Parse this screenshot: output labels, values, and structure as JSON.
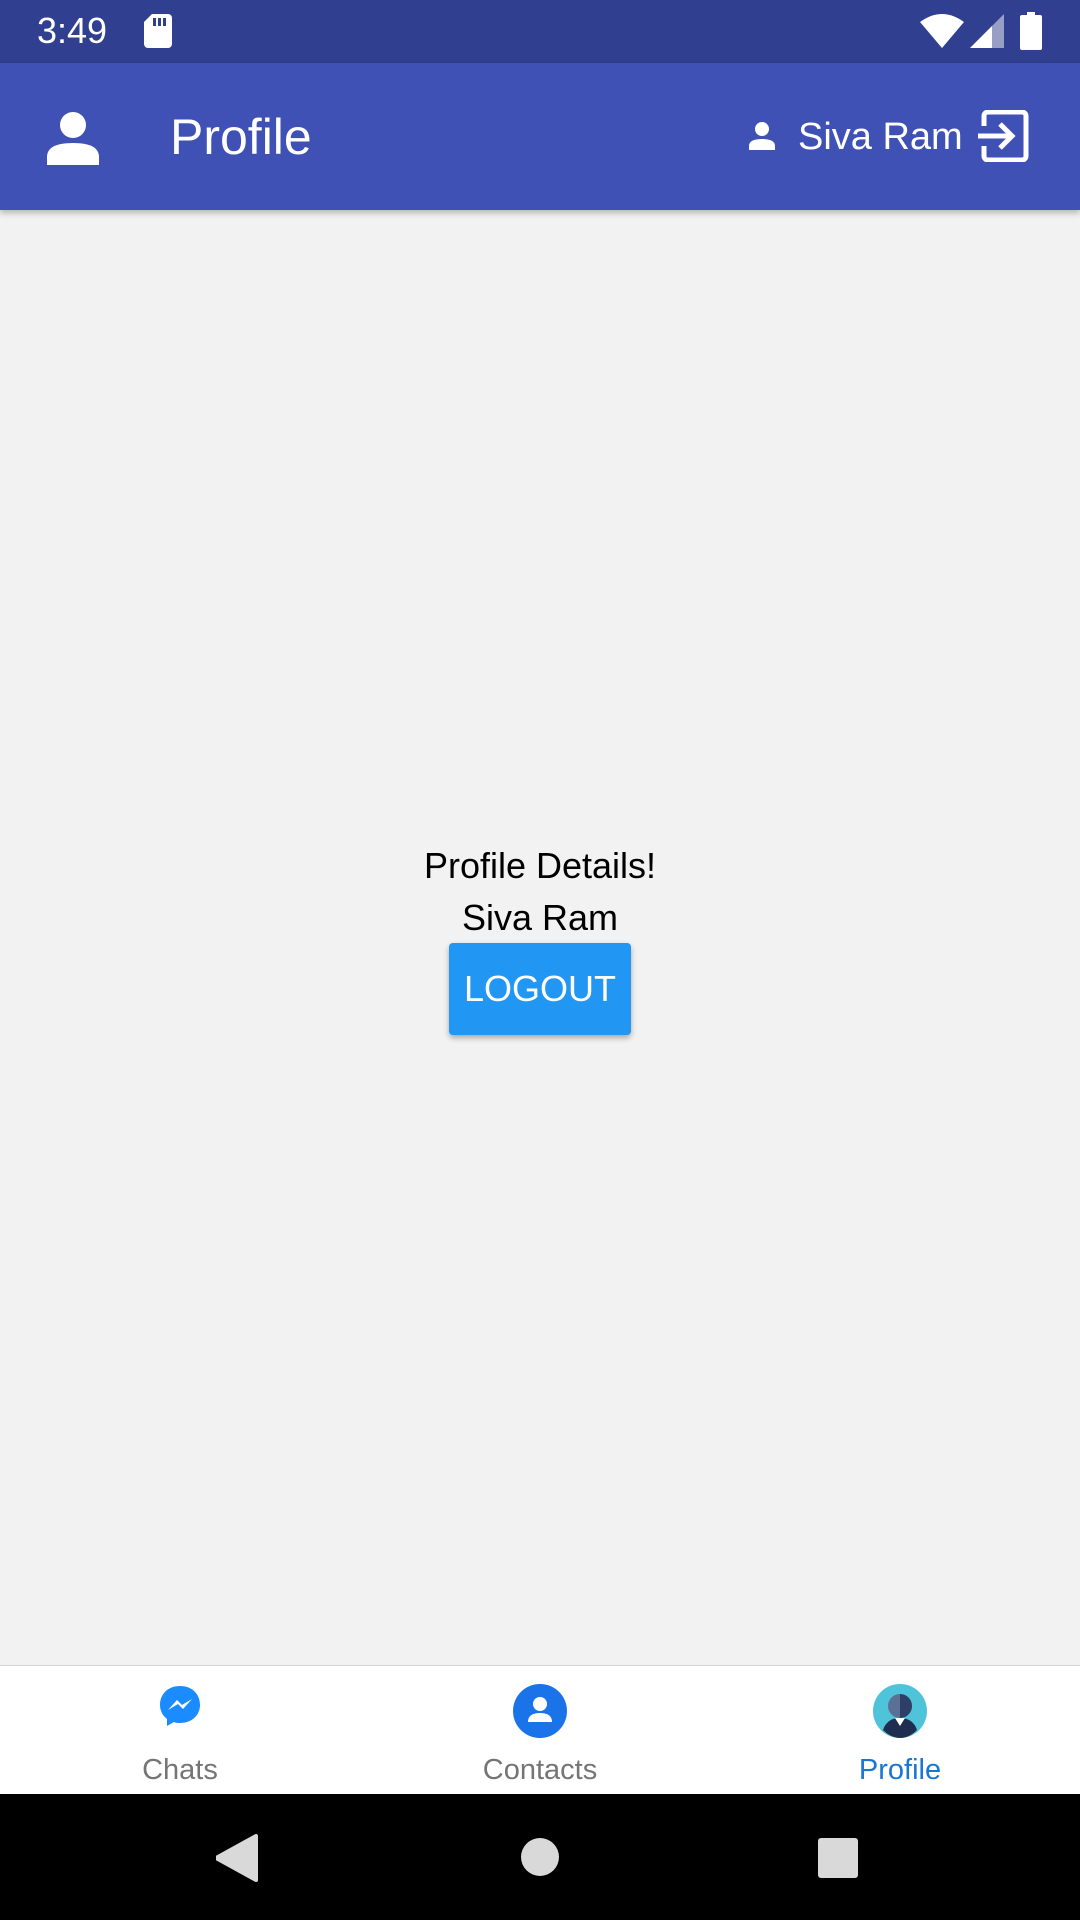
{
  "status_bar": {
    "time": "3:49",
    "icons": [
      "sd-card-icon",
      "wifi-icon",
      "signal-icon",
      "battery-icon"
    ]
  },
  "app_bar": {
    "icon": "person-icon",
    "title": "Profile",
    "user_icon": "person-small-icon",
    "user_name": "Siva Ram",
    "action_icon": "exit-icon",
    "background": "#3f51b5"
  },
  "content": {
    "title": "Profile Details!",
    "name": "Siva Ram",
    "logout_label": "LOGOUT",
    "button_color": "#2196f3"
  },
  "bottom_nav": {
    "items": [
      {
        "label": "Chats",
        "icon": "messenger-icon",
        "active": false
      },
      {
        "label": "Contacts",
        "icon": "contact-icon",
        "active": false
      },
      {
        "label": "Profile",
        "icon": "profile-avatar-icon",
        "active": true
      }
    ],
    "active_color": "#1976d2"
  },
  "system_nav": {
    "icons": [
      "back-icon",
      "home-icon",
      "recents-icon"
    ]
  }
}
